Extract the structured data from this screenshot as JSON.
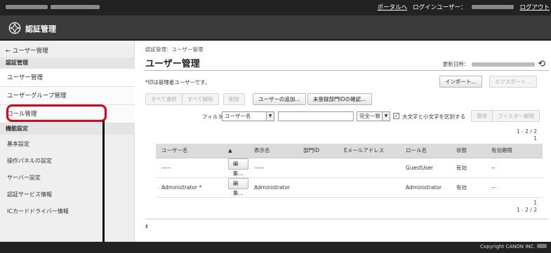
{
  "topbar": {
    "portal_link": "ポータルへ",
    "login_user_label": "ログインユーザー：",
    "logout_link": "ログアウト"
  },
  "header": {
    "app_title": "認証管理",
    "logo_icon": "gear-wheel-logo-icon"
  },
  "sidebar": {
    "back_link": "← ユーザー管理",
    "section1_heading": "認証管理",
    "items": [
      {
        "label": "ユーザー管理"
      },
      {
        "label": "ユーザーグループ管理"
      },
      {
        "label": "ロール管理"
      }
    ],
    "section2_heading": "機能設定",
    "sub_items": [
      {
        "label": "基本設定"
      },
      {
        "label": "操作パネルの設定"
      },
      {
        "label": "サーバー設定"
      },
      {
        "label": "認証サービス情報"
      },
      {
        "label": "ICカードドライバー情報"
      }
    ]
  },
  "main": {
    "breadcrumb": "認証管理：ユーザー管理",
    "title": "ユーザー管理",
    "updated_label": "更新日時：",
    "note": "*印は管理者ユーザーです。",
    "import_button": "インポート…",
    "export_button": "エクスポート…",
    "toolbar": {
      "select_all": "すべて選択",
      "deselect_all": "すべて解除",
      "delete": "削除",
      "add_user": "ユーザーの追加…",
      "check_unregistered_dept": "未登録部門IDの確認…"
    },
    "filter": {
      "label": "フィルター：",
      "field_value": "ユーザー名",
      "text_value": "",
      "match_value": "完全一致",
      "case_sensitive_label": "大文字と小文字を区別する",
      "case_sensitive_checked": true,
      "apply_button": "適用",
      "clear_button": "フィルター解除"
    },
    "pager_top": {
      "range": "1 - 2 / 2",
      "page": "1"
    },
    "pager_bottom": {
      "page": "1",
      "range": "1 - 2 / 2"
    },
    "table": {
      "columns": [
        "ユーザー名",
        "▲",
        "表示名",
        "部門ID",
        "Eメールアドレス",
        "ロール名",
        "状態",
        "有効期限"
      ],
      "edit_label": "編集…",
      "rows": [
        {
          "user_name": "-----",
          "admin_mark": "",
          "display_name": "-----",
          "dept_id": "",
          "email": "",
          "role": "GuestUser",
          "status": "有効",
          "expires": "--"
        },
        {
          "user_name": "Administrator",
          "admin_mark": "*",
          "display_name": "Administrator",
          "dept_id": "",
          "email": "",
          "role": "Administrator",
          "status": "有効",
          "expires": "--"
        }
      ]
    },
    "to_top_icon": "to-top-arrow-icon",
    "to_top_glyph": "⯒"
  },
  "footer": {
    "copyright": "Copyright CANON INC."
  },
  "colors": {
    "highlight_red": "#e60012",
    "top_bar": "#222222",
    "title_bar": "#3b3b3b",
    "sidebar_bg": "#efefef"
  }
}
